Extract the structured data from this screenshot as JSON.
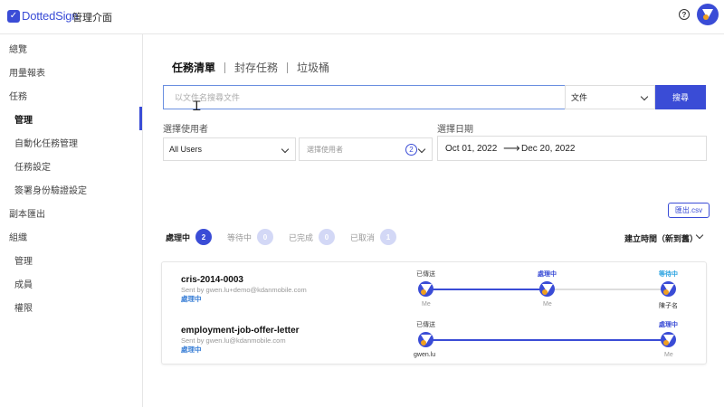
{
  "app": {
    "brand": "DottedSign",
    "page_title": "管理介面"
  },
  "colors": {
    "accent": "#3a4cd6",
    "status_blue": "#3a7fd6",
    "waiting_cyan": "#2aa3e0"
  },
  "sidebar": {
    "items": [
      {
        "label": "總覽"
      },
      {
        "label": "用量報表"
      },
      {
        "label": "任務"
      },
      {
        "label": "管理"
      },
      {
        "label": "自動化任務管理"
      },
      {
        "label": "任務設定"
      },
      {
        "label": "簽署身份驗證設定"
      },
      {
        "label": "副本匯出"
      },
      {
        "label": "組織"
      },
      {
        "label": "管理"
      },
      {
        "label": "成員"
      },
      {
        "label": "權限"
      }
    ]
  },
  "tabs": [
    {
      "label": "任務清單"
    },
    {
      "label": "封存任務"
    },
    {
      "label": "垃圾桶"
    }
  ],
  "search": {
    "placeholder": "以文件名搜尋文件",
    "type_selected": "文件",
    "button_label": "搜尋"
  },
  "filters": {
    "user_label": "選擇使用者",
    "user_selected": "All Users",
    "user_picker_placeholder": "選擇使用者",
    "user_picker_count": "2",
    "date_label": "選擇日期",
    "date_start": "Oct 01, 2022",
    "date_end": "Dec 20, 2022"
  },
  "export": {
    "label": "匯出.csv"
  },
  "status_tabs": [
    {
      "label": "處理中",
      "count": "2"
    },
    {
      "label": "等待中",
      "count": "0"
    },
    {
      "label": "已完成",
      "count": "0"
    },
    {
      "label": "已取消",
      "count": "1"
    }
  ],
  "sort": {
    "label": "建立時間（新到舊）"
  },
  "tasks": [
    {
      "name": "cris-2014-0003",
      "sender": "Sent by gwen.lu+demo@kdanmobile.com",
      "status": "處理中",
      "steps": [
        {
          "top": "已傳送",
          "bottom": "Me"
        },
        {
          "top": "處理中",
          "bottom": "Me"
        },
        {
          "top": "等待中",
          "bottom": "陳子名"
        }
      ]
    },
    {
      "name": "employment-job-offer-letter",
      "sender": "Sent by gwen.lu@kdanmobile.com",
      "status": "處理中",
      "steps": [
        {
          "top": "已傳送",
          "bottom": "gwen.lu"
        },
        {
          "top": "處理中",
          "bottom": "Me"
        }
      ]
    }
  ]
}
